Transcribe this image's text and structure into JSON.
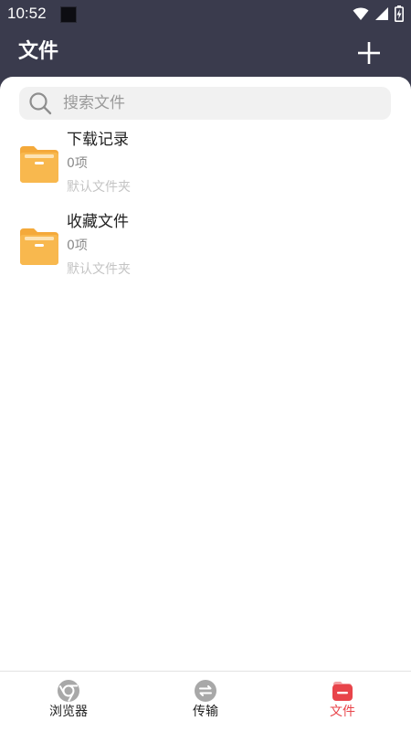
{
  "status_bar": {
    "time": "10:52"
  },
  "header": {
    "title": "文件",
    "add_icon": "plus-icon"
  },
  "search": {
    "placeholder": "搜索文件",
    "value": "",
    "icon": "search-icon"
  },
  "folders": [
    {
      "name": "下载记录",
      "count": "0项",
      "description": "默认文件夹",
      "icon": "folder-icon"
    },
    {
      "name": "收藏文件",
      "count": "0项",
      "description": "默认文件夹",
      "icon": "folder-icon"
    }
  ],
  "bottom_nav": [
    {
      "label": "浏览器",
      "icon": "browser-icon",
      "active": false
    },
    {
      "label": "传输",
      "icon": "transfer-icon",
      "active": false
    },
    {
      "label": "文件",
      "icon": "file-icon",
      "active": true
    }
  ],
  "colors": {
    "header_bg": "#3a3b4d",
    "folder": "#f8b84e",
    "active_tab": "#e8444a",
    "inactive_icon": "#a8a8a8"
  }
}
